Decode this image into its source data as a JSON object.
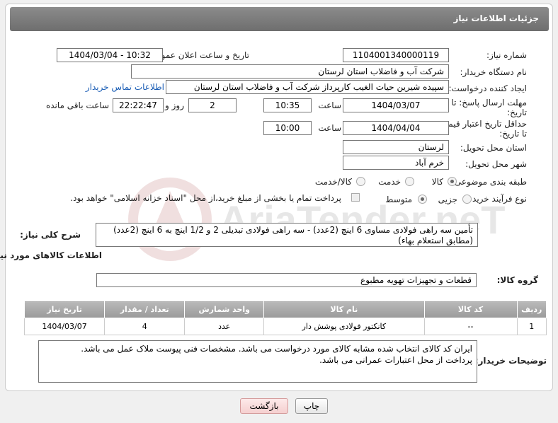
{
  "header": {
    "title": "جزئیات اطلاعات نیاز"
  },
  "fields": {
    "need_number_label": "شماره نیاز:",
    "need_number": "1104001340000119",
    "announce_label": "تاریخ و ساعت اعلان عمومی:",
    "announce_value": "1404/03/04 - 10:32",
    "buyer_org_label": "نام دستگاه خریدار:",
    "buyer_org": "شرکت آب و فاضلاب استان لرستان",
    "creator_label": "ایجاد کننده درخواست:",
    "creator": "سپیده شیرین حیات الغیب کارپرداز شرکت آب و فاضلاب استان لرستان",
    "buyer_contact_link": "اطلاعات تماس خریدار",
    "deadline_label_1": "مهلت ارسال پاسخ: تا",
    "deadline_label_2": "تاریخ:",
    "deadline_date": "1404/03/07",
    "time_label": "ساعت",
    "deadline_time": "10:35",
    "days_value": "2",
    "days_label": "روز و",
    "remaining_time": "22:22:47",
    "remaining_label": "ساعت باقی مانده",
    "validity_label_1": "حداقل تاریخ اعتبار قیمت:",
    "validity_label_2": "تا تاریخ:",
    "validity_date": "1404/04/04",
    "validity_time": "10:00",
    "province_label": "استان محل تحویل:",
    "province": "لرستان",
    "city_label": "شهر محل تحویل:",
    "city": "خرم آباد",
    "category_label": "طبقه بندی موضوعی:",
    "category_options": [
      "کالا",
      "خدمت",
      "کالا/خدمت"
    ],
    "process_label": "نوع فرآیند خرید :",
    "process_options": [
      "جزیی",
      "متوسط"
    ],
    "payment_note": "پرداخت تمام یا بخشی از مبلغ خرید،از محل \"اسناد خزانه اسلامی\" خواهد بود.",
    "summary_label": "شرح کلی نیاز:",
    "summary_line1": "تأمین سه راهی فولادی مساوی 6 اینچ (2عدد) - سه راهی فولادی تبدیلی 2 و 1/2 اینچ به 6 اینچ (2عدد)",
    "summary_line2": "(مطابق استعلام بهاء)",
    "goods_info_title": "اطلاعات کالاهای مورد نیاز",
    "goods_group_label": "گروه کالا:",
    "goods_group": "قطعات و تجهیزات تهویه مطبوع"
  },
  "table": {
    "headers": [
      "ردیف",
      "کد کالا",
      "نام کالا",
      "واحد شمارش",
      "تعداد / مقدار",
      "تاریخ نیاز"
    ],
    "rows": [
      [
        "1",
        "--",
        "کانکتور فولادی پوشش دار",
        "عدد",
        "4",
        "1404/03/07"
      ]
    ]
  },
  "buyer_notes": {
    "label": "توضیحات خریدار:",
    "line1": "ایران کد کالای انتخاب شده مشابه کالای مورد درخواست می باشد. مشخصات فنی پیوست ملاک عمل می باشد.",
    "line2": "پرداخت از محل اعتبارات عمرانی می باشد."
  },
  "buttons": {
    "print": "چاپ",
    "back": "بازگشت"
  },
  "colors": {
    "header": "#7a7a7a",
    "link": "#1a5db5",
    "back_button": "#f8d7d7"
  },
  "watermark": {
    "text": "AriaTender.neT"
  }
}
